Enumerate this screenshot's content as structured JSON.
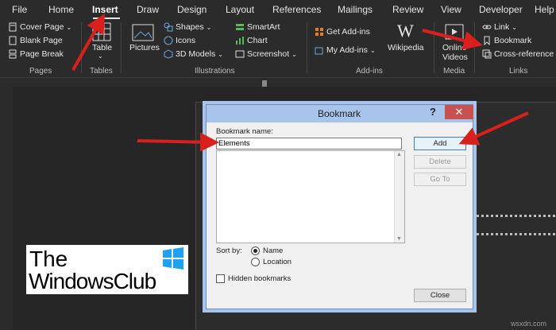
{
  "ribbon_tabs": [
    "File",
    "Home",
    "Insert",
    "Draw",
    "Design",
    "Layout",
    "References",
    "Mailings",
    "Review",
    "View",
    "Developer",
    "Help"
  ],
  "active_tab": "Insert",
  "ribbon": {
    "pages": {
      "cover_page": "Cover Page",
      "blank_page": "Blank Page",
      "page_break": "Page Break",
      "label": "Pages"
    },
    "tables": {
      "table": "Table",
      "label": "Tables"
    },
    "illustrations": {
      "pictures": "Pictures",
      "shapes": "Shapes",
      "icons": "Icons",
      "models": "3D Models",
      "smartart": "SmartArt",
      "chart": "Chart",
      "screenshot": "Screenshot",
      "label": "Illustrations"
    },
    "addins": {
      "get": "Get Add-ins",
      "my": "My Add-ins",
      "wikipedia": "Wikipedia",
      "label": "Add-ins"
    },
    "media": {
      "online_videos_1": "Online",
      "online_videos_2": "Videos",
      "label": "Media"
    },
    "links": {
      "link": "Link",
      "bookmark": "Bookmark",
      "cross_reference": "Cross-reference",
      "label": "Links"
    }
  },
  "dialog": {
    "title": "Bookmark",
    "help": "?",
    "close": "✕",
    "name_label": "Bookmark name:",
    "name_value": "Elements",
    "add": "Add",
    "delete": "Delete",
    "goto": "Go To",
    "sort_by": "Sort by:",
    "sort_options": [
      "Name",
      "Location"
    ],
    "sort_selected": "Name",
    "hidden_label": "Hidden bookmarks",
    "close_button": "Close"
  },
  "logo": {
    "line1": "The",
    "line2": "WindowsClub"
  },
  "watermark": "wsxdn.com",
  "colors": {
    "arrow": "#d9201c",
    "dialog_frame": "#a8c4ea",
    "close_red": "#c75050"
  }
}
